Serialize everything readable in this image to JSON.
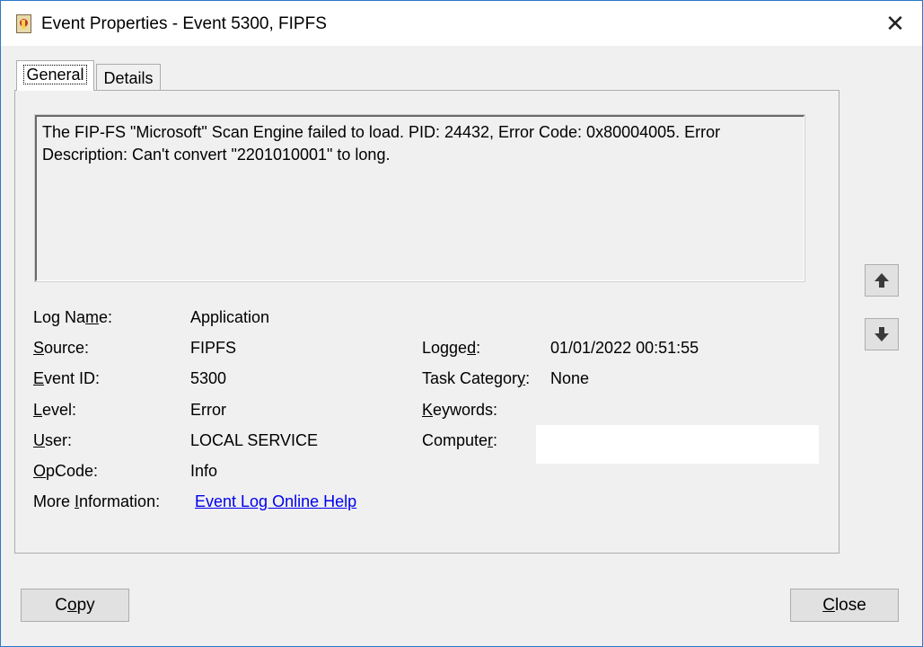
{
  "window": {
    "title": "Event Properties - Event 5300, FIPFS",
    "close_glyph": "✕"
  },
  "tabs": [
    {
      "label": "General",
      "active": true
    },
    {
      "label": "Details",
      "active": false
    }
  ],
  "event": {
    "description": "The FIP-FS \"Microsoft\" Scan Engine failed to load. PID: 24432, Error Code: 0x80004005. Error\nDescription: Can't convert \"2201010001\" to long.",
    "log_name": {
      "label_pre": "Log Na",
      "label_u": "m",
      "label_post": "e:",
      "value": "Application"
    },
    "source": {
      "label_pre": "",
      "label_u": "S",
      "label_post": "ource:",
      "value": "FIPFS"
    },
    "event_id": {
      "label_pre": "",
      "label_u": "E",
      "label_post": "vent ID:",
      "value": "5300"
    },
    "level": {
      "label_pre": "",
      "label_u": "L",
      "label_post": "evel:",
      "value": "Error"
    },
    "user": {
      "label_pre": "",
      "label_u": "U",
      "label_post": "ser:",
      "value": "LOCAL SERVICE"
    },
    "opcode": {
      "label_pre": "",
      "label_u": "O",
      "label_post": "pCode:",
      "value": "Info"
    },
    "more_info": {
      "label_pre": "More ",
      "label_u": "I",
      "label_post": "nformation:",
      "link": "Event Log Online Help"
    },
    "logged": {
      "label_pre": "Logge",
      "label_u": "d",
      "label_post": ":",
      "value": "01/01/2022 00:51:55"
    },
    "task_category": {
      "label_pre": "Task Categor",
      "label_u": "y",
      "label_post": ":",
      "value": "None"
    },
    "keywords": {
      "label_pre": "",
      "label_u": "K",
      "label_post": "eywords:",
      "value": ""
    },
    "computer": {
      "label_pre": "Compute",
      "label_u": "r",
      "label_post": ":",
      "value": ""
    }
  },
  "nav": {
    "up_icon": "arrow-up-icon",
    "down_icon": "arrow-down-icon"
  },
  "buttons": {
    "copy": {
      "pre": "C",
      "u": "o",
      "post": "py"
    },
    "close": {
      "pre": "",
      "u": "C",
      "post": "lose"
    }
  }
}
